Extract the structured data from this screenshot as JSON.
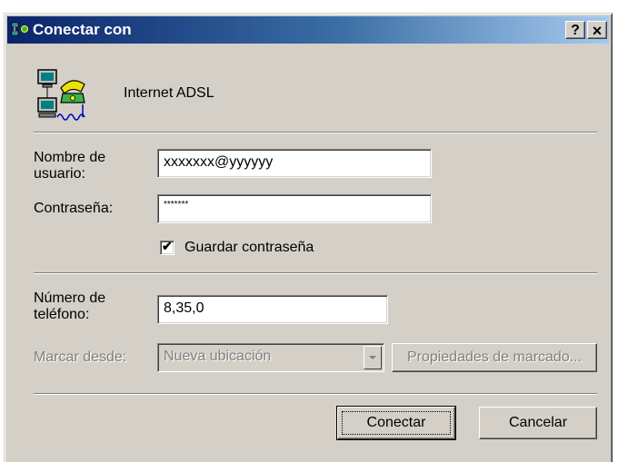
{
  "window": {
    "title": "Conectar con",
    "help_label": "?",
    "close_label": "×"
  },
  "connection": {
    "name": "Internet ADSL",
    "icon": "dial-up-connection-icon"
  },
  "fields": {
    "username": {
      "label_line1": "Nombre de",
      "label_line2": "usuario:",
      "value": "xxxxxxx@yyyyyy"
    },
    "password": {
      "label": "Contraseña:",
      "value": "*******"
    },
    "save_password": {
      "label": "Guardar contraseña",
      "checked": true,
      "check_glyph": "✔"
    },
    "phone": {
      "label_line1": "Número de",
      "label_line2": "teléfono:",
      "value": "8,35,0"
    },
    "dial_from": {
      "label": "Marcar desde:",
      "value": "Nueva ubicación",
      "enabled": false
    }
  },
  "buttons": {
    "dial_properties": "Propiedades de marcado...",
    "connect": "Conectar",
    "cancel": "Cancelar"
  },
  "colors": {
    "titlebar_start": "#0a246a",
    "titlebar_end": "#a6caf0",
    "face": "#d4d0c8"
  }
}
